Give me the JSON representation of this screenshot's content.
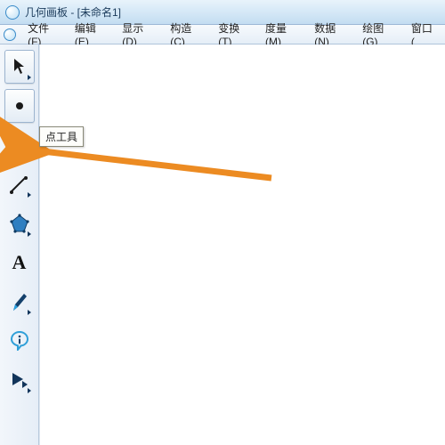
{
  "window": {
    "title": "几何画板 - [未命名1]"
  },
  "menus": [
    {
      "label": "文件(F)"
    },
    {
      "label": "编辑(E)"
    },
    {
      "label": "显示(D)"
    },
    {
      "label": "构造(C)"
    },
    {
      "label": "变换(T)"
    },
    {
      "label": "度量(M)"
    },
    {
      "label": "数据(N)"
    },
    {
      "label": "绘图(G)"
    },
    {
      "label": "窗口("
    }
  ],
  "tooltip": {
    "text": "点工具"
  },
  "tools": {
    "select": "select-arrow",
    "point": "point",
    "circle": "compass-circle",
    "line": "line-segment",
    "polygon": "polygon",
    "text": "text",
    "marker": "marker-pen",
    "info": "information",
    "custom": "custom-tool"
  },
  "colors": {
    "accent_orange": "#ec8b22",
    "poly_fill": "#2f7fc1",
    "info_blue": "#2f9fd8"
  }
}
